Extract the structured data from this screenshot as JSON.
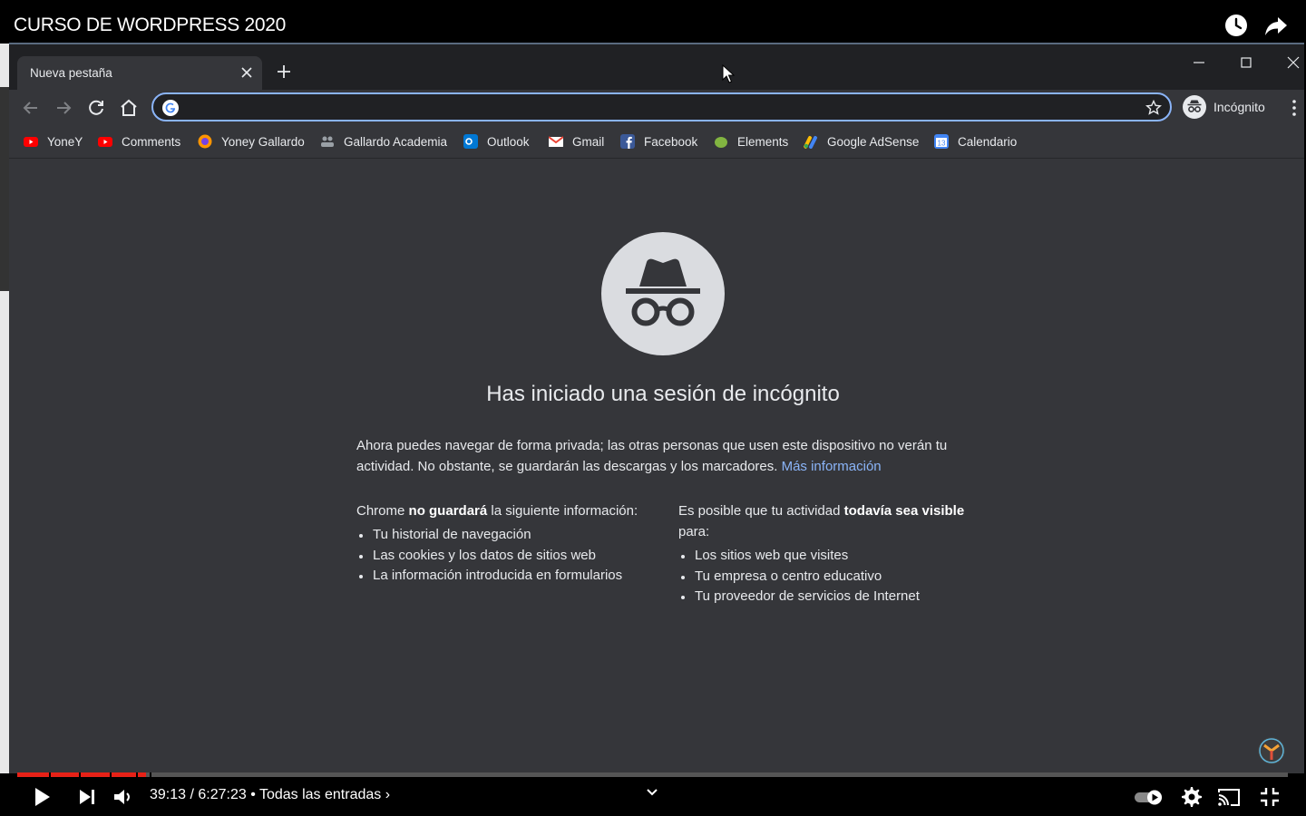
{
  "youtube": {
    "video_title": "CURSO DE WORDPRESS 2020",
    "time_current": "39:13",
    "time_total": "6:27:23",
    "time_display": "39:13 / 6:27:23 • Todas las entradas ›",
    "progress_percent": 10.1,
    "icons": [
      "clock-icon",
      "share-icon",
      "play-icon",
      "next-icon",
      "volume-icon",
      "chevron-down-icon",
      "autoplay-toggle-icon",
      "settings-icon",
      "cast-icon",
      "exit-fullscreen-icon"
    ]
  },
  "chrome": {
    "tab_title": "Nueva pestaña",
    "profile_label": "Incógnito",
    "omnibox_value": "",
    "accent_color": "#8ab4f8",
    "bookmarks": [
      {
        "label": "YoneY",
        "icon": "youtube-icon",
        "color": "#ff0000"
      },
      {
        "label": "Comments",
        "icon": "youtube-icon",
        "color": "#ff0000"
      },
      {
        "label": "Yoney Gallardo",
        "icon": "firefox-icon",
        "color": "#ff9500"
      },
      {
        "label": "Gallardo Academia",
        "icon": "people-icon",
        "color": "#9aa0a6"
      },
      {
        "label": "Outlook",
        "icon": "outlook-icon",
        "color": "#0078d4"
      },
      {
        "label": "Gmail",
        "icon": "gmail-icon",
        "color": "#ea4335"
      },
      {
        "label": "Facebook",
        "icon": "facebook-icon",
        "color": "#3b5998"
      },
      {
        "label": "Elements",
        "icon": "leaf-icon",
        "color": "#82b541"
      },
      {
        "label": "Google AdSense",
        "icon": "adsense-icon",
        "color": "#fbbc04"
      },
      {
        "label": "Calendario",
        "icon": "calendar-icon",
        "color": "#4285f4"
      }
    ]
  },
  "incognito_page": {
    "heading": "Has iniciado una sesión de incógnito",
    "intro_text": "Ahora puedes navegar de forma privada; las otras personas que usen este dispositivo no verán tu actividad. No obstante, se guardarán las descargas y los marcadores.",
    "learn_more": "Más información",
    "left_column": {
      "title_prefix": "Chrome ",
      "title_bold": "no guardará",
      "title_suffix": " la siguiente información:",
      "items": [
        "Tu historial de navegación",
        "Las cookies y los datos de sitios web",
        "La información introducida en formularios"
      ]
    },
    "right_column": {
      "title_prefix": "Es posible que tu actividad ",
      "title_bold": "todavía sea visible",
      "title_suffix": " para:",
      "items": [
        "Los sitios web que visites",
        "Tu empresa o centro educativo",
        "Tu proveedor de servicios de Internet"
      ]
    }
  }
}
